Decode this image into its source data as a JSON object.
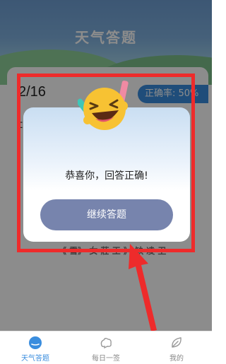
{
  "header": {
    "title": "天气答题"
  },
  "quiz": {
    "progress": "2/16",
    "accuracy_label": "正确率: 50%",
    "question_fragment": "t",
    "option_fragment": "《 雪》 女 莊 王 》 缺 凌 卫"
  },
  "dialog": {
    "message": "恭喜你，回答正确!",
    "continue_label": "继续答题",
    "emoji_icon": "laughing-face-icon"
  },
  "nav": {
    "items": [
      {
        "label": "天气答题",
        "icon": "weather-quiz-icon",
        "active": true
      },
      {
        "label": "每日一签",
        "icon": "daily-sign-icon",
        "active": false
      },
      {
        "label": "我的",
        "icon": "leaf-icon",
        "active": false
      }
    ]
  },
  "colors": {
    "accent": "#3a8dde",
    "button": "#7784ad",
    "annotation": "#ee2b2b"
  }
}
